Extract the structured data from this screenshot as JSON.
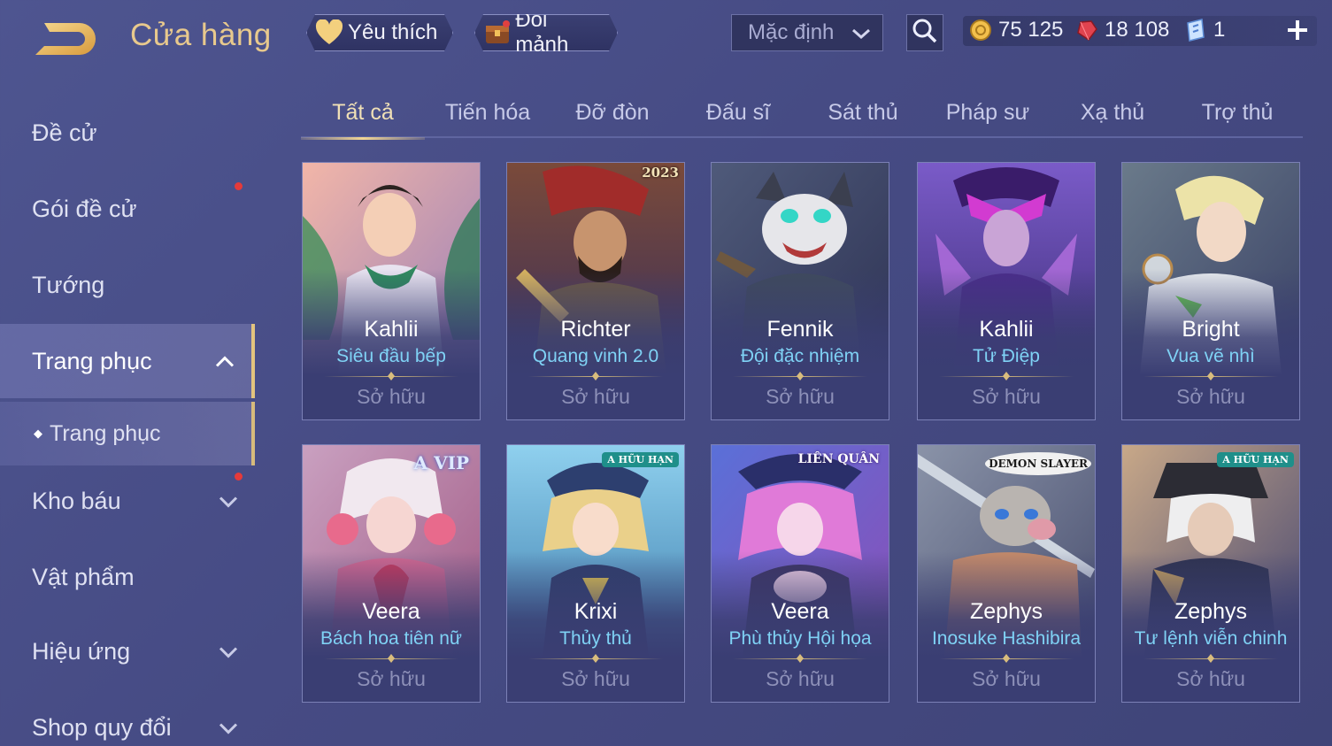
{
  "header": {
    "title": "Cửa hàng",
    "favorite_label": "Yêu thích",
    "shard_label": "Đổi mảnh",
    "sort_value": "Mặc định"
  },
  "currency": {
    "gold": "75 125",
    "ruby": "18 108",
    "token": "1"
  },
  "sidebar": {
    "items": [
      {
        "label": "Đề cử"
      },
      {
        "label": "Gói đề cử"
      },
      {
        "label": "Tướng"
      },
      {
        "label": "Trang phục"
      },
      {
        "label": "Trang phục"
      },
      {
        "label": "Kho báu"
      },
      {
        "label": "Vật phẩm"
      },
      {
        "label": "Hiệu ứng"
      },
      {
        "label": "Shop quy đổi"
      }
    ]
  },
  "tabs": [
    {
      "label": "Tất cả"
    },
    {
      "label": "Tiến hóa"
    },
    {
      "label": "Đỡ đòn"
    },
    {
      "label": "Đấu sĩ"
    },
    {
      "label": "Sát thủ"
    },
    {
      "label": "Pháp sư"
    },
    {
      "label": "Xạ thủ"
    },
    {
      "label": "Trợ thủ"
    }
  ],
  "cards": [
    {
      "hero": "Kahlii",
      "skin": "Siêu đầu bếp",
      "status": "Sở hữu",
      "badge": ""
    },
    {
      "hero": "Richter",
      "skin": "Quang vinh 2.0",
      "status": "Sở hữu",
      "badge": "2023"
    },
    {
      "hero": "Fennik",
      "skin": "Đội đặc nhiệm",
      "status": "Sở hữu",
      "badge": ""
    },
    {
      "hero": "Kahlii",
      "skin": "Tử Điệp",
      "status": "Sở hữu",
      "badge": ""
    },
    {
      "hero": "Bright",
      "skin": "Vua vẽ nhì",
      "status": "Sở hữu",
      "badge": ""
    },
    {
      "hero": "Veera",
      "skin": "Bách hoa tiên nữ",
      "status": "Sở hữu",
      "badge": "A VIP"
    },
    {
      "hero": "Krixi",
      "skin": "Thủy thủ",
      "status": "Sở hữu",
      "badge": "A HỮU HẠN"
    },
    {
      "hero": "Veera",
      "skin": "Phù thủy Hội họa",
      "status": "Sở hữu",
      "badge": "LIÊN QUÂN"
    },
    {
      "hero": "Zephys",
      "skin": "Inosuke Hashibira",
      "status": "Sở hữu",
      "badge": "DEMON SLAYER"
    },
    {
      "hero": "Zephys",
      "skin": "Tư lệnh viễn chinh",
      "status": "Sở hữu",
      "badge": "A HỮU HẠN"
    }
  ]
}
